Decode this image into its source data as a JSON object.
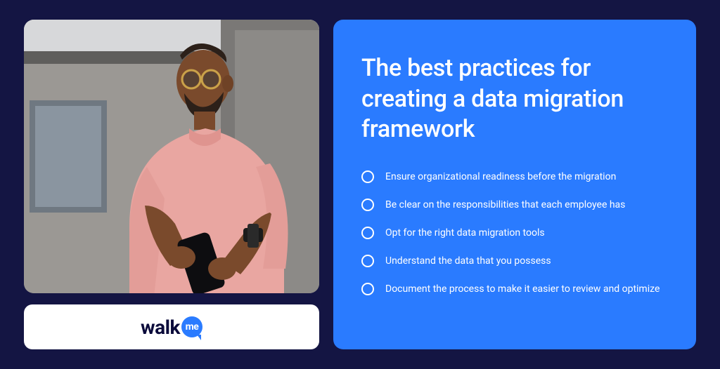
{
  "logo": {
    "text_part1": "walk",
    "text_part2": "me"
  },
  "panel": {
    "title": "The best practices for creating a data migration framework",
    "bullets": [
      "Ensure organizational readiness before the migration",
      "Be clear on the responsibilities that each employee has",
      "Opt for the right data migration tools",
      "Understand the data that you possess",
      "Document the process to make it easier to review and optimize"
    ]
  }
}
